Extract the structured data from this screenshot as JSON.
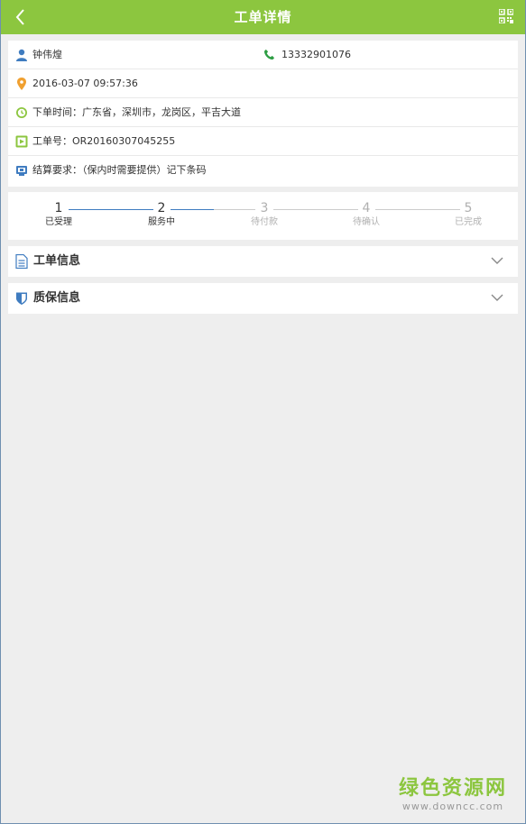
{
  "header": {
    "title": "工单详情",
    "back_icon": "chevron-left-icon",
    "qr_icon": "qr-code-icon"
  },
  "customer": {
    "name": "钟伟煌",
    "phone": "13332901076",
    "datetime": "2016-03-07 09:57:36",
    "order_address": "下单时间：广东省，深圳市，龙岗区，平吉大道",
    "order_number": "工单号：OR20160307045255",
    "settlement": "结算要求：（保内时需要提供）记下条码"
  },
  "progress": {
    "current_step": 2,
    "steps": [
      {
        "num": "1",
        "label": "已受理"
      },
      {
        "num": "2",
        "label": "服务中"
      },
      {
        "num": "3",
        "label": "待付款"
      },
      {
        "num": "4",
        "label": "待确认"
      },
      {
        "num": "5",
        "label": "已完成"
      }
    ]
  },
  "sections": {
    "order_info": "工单信息",
    "warranty_info": "质保信息"
  },
  "watermark": {
    "title": "绿色资源网",
    "url": "www.downcc.com"
  },
  "colors": {
    "brand": "#8cc63f",
    "accent_blue": "#3f7cc0",
    "phone_green": "#2e9e44",
    "location_orange": "#f0a030"
  }
}
